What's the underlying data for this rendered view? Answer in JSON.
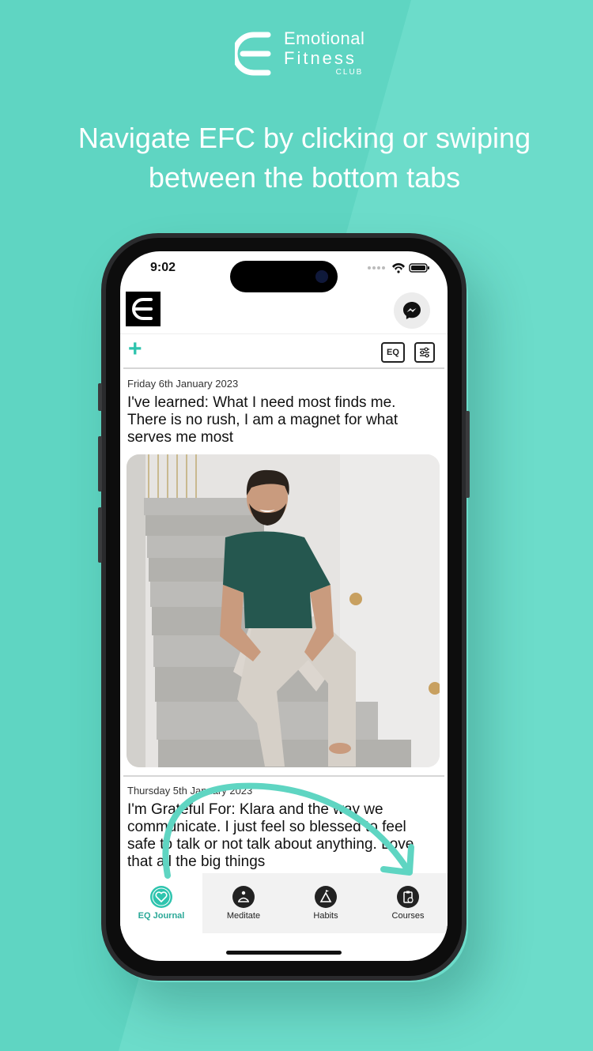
{
  "brand": {
    "line1": "Emotional",
    "line2": "Fitness",
    "line3": "CLUB"
  },
  "headline": {
    "line1": "Navigate EFC by clicking or swiping",
    "line2": "between the bottom tabs"
  },
  "status_bar": {
    "time": "9:02"
  },
  "toolbar": {
    "eq_label": "EQ",
    "add_label": "+"
  },
  "entries": [
    {
      "date": "Friday 6th January 2023",
      "text": "I've learned: What I need most finds me. There is no rush, I am a magnet for what serves me most"
    },
    {
      "date": "Thursday 5th January 2023",
      "text": "I'm Grateful For: Klara and the way we communicate. I just feel so blessed to feel safe to talk or not talk about anything. Love that all the big things"
    }
  ],
  "tabs": [
    {
      "label": "EQ Journal",
      "icon": "heart-icon",
      "active": true
    },
    {
      "label": "Meditate",
      "icon": "meditate-icon",
      "active": false
    },
    {
      "label": "Habits",
      "icon": "habits-icon",
      "active": false
    },
    {
      "label": "Courses",
      "icon": "courses-icon",
      "active": false
    }
  ],
  "colors": {
    "background": "#5fd5c2",
    "accent": "#2ec4ae",
    "active_tab": "#2aa897"
  }
}
